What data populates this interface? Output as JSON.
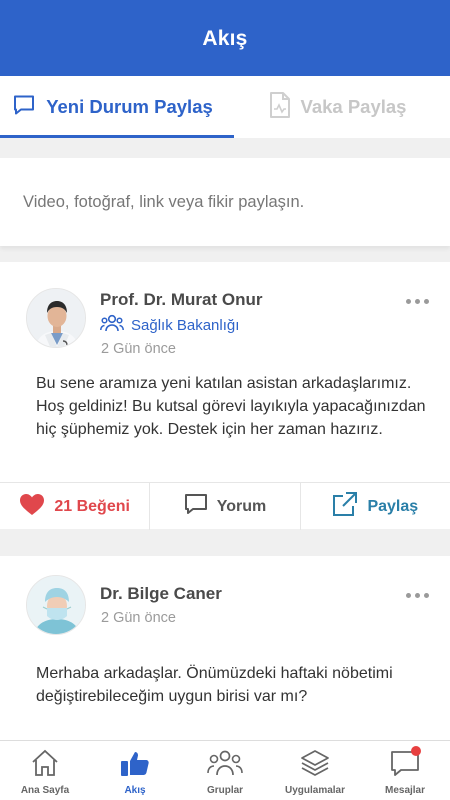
{
  "app": {
    "title": "Akış"
  },
  "tabs": [
    {
      "label": "Yeni Durum Paylaş",
      "icon": "chat-bubble-icon",
      "active": true
    },
    {
      "label": "Vaka Paylaş",
      "icon": "document-icon",
      "active": false
    }
  ],
  "composer": {
    "placeholder": "Video, fotoğraf, link veya fikir paylaşın."
  },
  "posts": [
    {
      "author": "Prof. Dr. Murat Onur",
      "organization": "Sağlık Bakanlığı",
      "time": "2 Gün önce",
      "text": "Bu sene aramıza yeni katılan asistan arkadaşlarımız. Hoş geldiniz! Bu kutsal görevi layıkıyla yapacağınızdan hiç şüphemiz yok. Destek için her zaman hazırız.",
      "actions": {
        "like": "21 Beğeni",
        "comment": "Yorum",
        "share": "Paylaş"
      }
    },
    {
      "author": "Dr. Bilge Caner",
      "time": "2 Gün önce",
      "text": "Merhaba arkadaşlar. Önümüzdeki haftaki nöbetimi değiştirebileceğim uygun birisi var mı?"
    }
  ],
  "bottom_nav": [
    {
      "label": "Ana Sayfa",
      "icon": "home-icon",
      "active": false
    },
    {
      "label": "Akış",
      "icon": "thumbs-up-icon",
      "active": true
    },
    {
      "label": "Gruplar",
      "icon": "group-icon",
      "active": false
    },
    {
      "label": "Uygulamalar",
      "icon": "layers-icon",
      "active": false
    },
    {
      "label": "Mesajlar",
      "icon": "message-icon",
      "active": false,
      "badge": true
    }
  ],
  "colors": {
    "primary": "#2e63c9",
    "like": "#e0474c",
    "share": "#2a7fa8",
    "badge": "#e84040"
  }
}
